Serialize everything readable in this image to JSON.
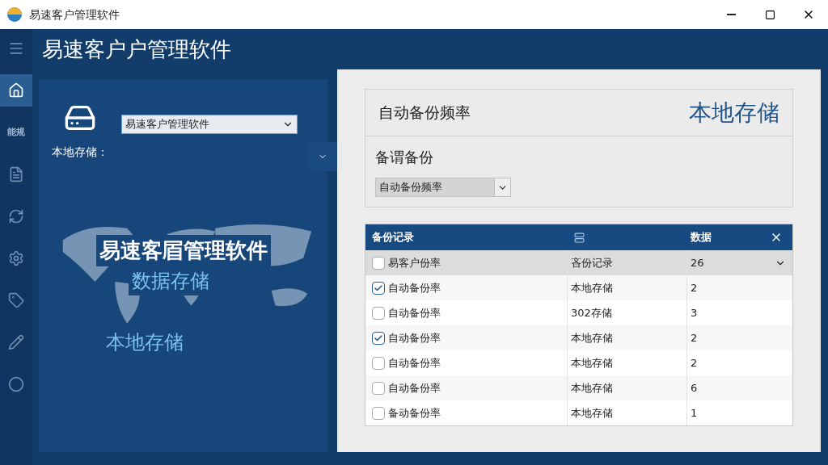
{
  "window": {
    "title": "易速客户管理软件"
  },
  "app_title": "易速客户户管理软件",
  "sidebar": {
    "items": [
      {
        "kind": "icon",
        "selected": false
      },
      {
        "kind": "icon",
        "selected": true
      },
      {
        "kind": "text",
        "label": "能规",
        "selected": false
      },
      {
        "kind": "icon",
        "selected": false
      },
      {
        "kind": "icon",
        "selected": false
      },
      {
        "kind": "icon",
        "selected": false
      },
      {
        "kind": "icon",
        "selected": false
      },
      {
        "kind": "icon",
        "selected": false
      },
      {
        "kind": "icon",
        "selected": false
      }
    ]
  },
  "left_panel": {
    "storage_label": "本地存储：",
    "select_value": "易速客户管理软件",
    "banner_title": "易速客㞒管理软件",
    "banner_subtitle": "数据存储",
    "banner_caption": "本地存储"
  },
  "settings": {
    "heading": "自动备份频率",
    "badge": "本地存储",
    "section": "备谓备份",
    "select_value": "自动备份频率"
  },
  "table": {
    "columns": [
      "备份记录",
      "",
      "数据"
    ],
    "rows": [
      {
        "checked": false,
        "selected": true,
        "cells": [
          "易客户份率",
          "吝份记录",
          "26"
        ]
      },
      {
        "checked": true,
        "selected": false,
        "cells": [
          "自动备份率",
          "本地存储",
          "2"
        ]
      },
      {
        "checked": false,
        "selected": false,
        "cells": [
          "自动备份率",
          "302存储",
          "3"
        ]
      },
      {
        "checked": true,
        "selected": false,
        "cells": [
          "自动备份率",
          "本地存储",
          "2"
        ]
      },
      {
        "checked": false,
        "selected": false,
        "cells": [
          "自动备份率",
          "本地存储",
          "2"
        ]
      },
      {
        "checked": false,
        "selected": false,
        "cells": [
          "自动备份率",
          "本地存储",
          "6"
        ]
      },
      {
        "checked": false,
        "selected": false,
        "cells": [
          "备动备份率",
          "本地存储",
          "1"
        ]
      }
    ]
  }
}
